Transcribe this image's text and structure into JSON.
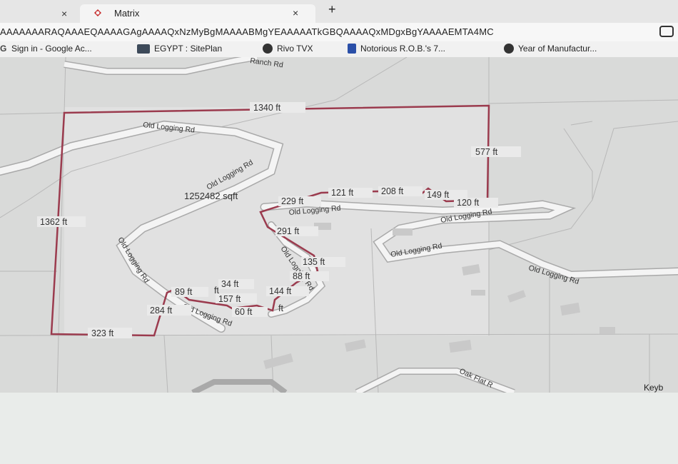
{
  "tabs": [
    {
      "title": "",
      "close_glyph": "×"
    },
    {
      "title": "Matrix",
      "close_glyph": "×"
    }
  ],
  "new_tab_glyph": "+",
  "address": {
    "url": "AAAAAAARAQAAAEQAAAAGAgAAAAQxNzMyBgMAAAABMgYEAAAAATkGBQAAAAQxMDgxBgYAAAAEMTA4MC"
  },
  "bookmarks": [
    {
      "label": "Sign in - Google Ac...",
      "icon": "google-icon"
    },
    {
      "label": "EGYPT : SitePlan",
      "icon": "siteplan-icon"
    },
    {
      "label": "Rivo TVX",
      "icon": "globe-icon"
    },
    {
      "label": "Notorious R.O.B.'s 7...",
      "icon": "bookmark-icon"
    },
    {
      "label": "Year of Manufactur...",
      "icon": "globe-icon"
    }
  ],
  "map": {
    "road_labels": {
      "ranch": "Ranch Rd",
      "old_logging_1": "Old Logging Rd",
      "old_logging_2": "Old Logging Rd",
      "old_logging_3": "Old Logging Rd",
      "old_logging_4": "Old Logging Rd",
      "old_logging_5": "Old Logging Rd",
      "old_logging_6": "Old Logging Rd",
      "old_logging_7": "Old Logging Rd",
      "old_logging_8": "Old Logging Rd",
      "old_logging_9": "Old Logging Rd",
      "oak_flat": "Oak Flat R",
      "keyboard": "Keyb"
    },
    "area": "1252482 sqft",
    "dimensions": {
      "top": "1340 ft",
      "right": "577 ft",
      "left": "1362 ft",
      "bottom": "323 ft",
      "d284": "284 ft",
      "d89": "89 ft",
      "d34": "34 ft",
      "d157": "157 ft",
      "d60": "60 ft",
      "d144": "144 ft",
      "d88": "88 ft",
      "d135": "135 ft",
      "d291": "291 ft",
      "d229": "229 ft",
      "d121": "121 ft",
      "d208": "208 ft",
      "d149": "149 ft",
      "d120": "120 ft",
      "d_partial": "ft",
      "d_partial2": "ft"
    }
  },
  "colors": {
    "boundary": "#9b3b4e",
    "road": "#ffffff",
    "road_edge": "#a9a9a9",
    "parcel_line": "#b0b0b0"
  }
}
